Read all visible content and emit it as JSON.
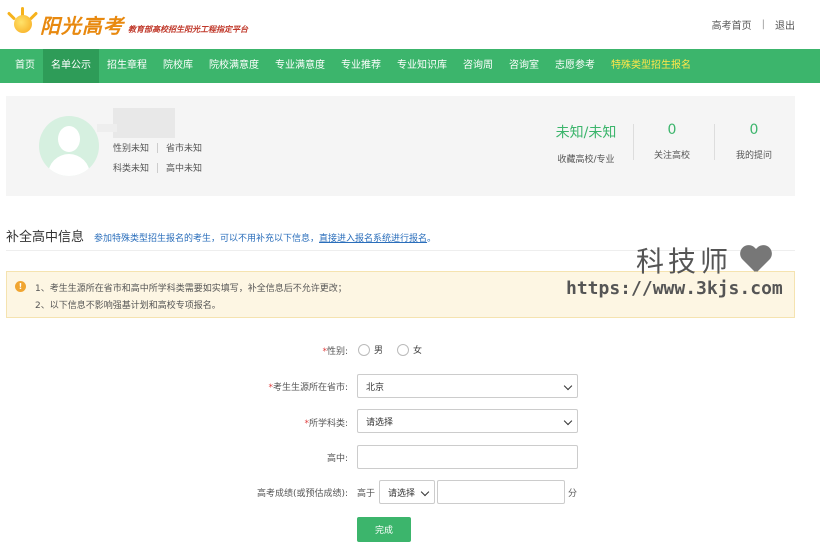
{
  "header": {
    "logo_title": "阳光高考",
    "logo_subtitle": "教育部高校招生阳光工程指定平台",
    "links": [
      "高考首页",
      "退出"
    ],
    "separator": "|"
  },
  "nav": {
    "items": [
      "首页",
      "名单公示",
      "招生章程",
      "院校库",
      "院校满意度",
      "专业满意度",
      "专业推荐",
      "专业知识库",
      "咨询周",
      "咨询室",
      "志愿参考",
      "特殊类型招生报名"
    ],
    "active_index": 1,
    "accent_color": "#3cb56c",
    "special_color": "#ffe64a"
  },
  "profile": {
    "gender": "性别未知",
    "province": "省市未知",
    "subject": "科类未知",
    "school": "高中未知",
    "stats": [
      {
        "value": "未知/未知",
        "label": "收藏高校/专业"
      },
      {
        "value": "0",
        "label": "关注高校"
      },
      {
        "value": "0",
        "label": "我的提问"
      }
    ]
  },
  "section": {
    "title": "补全高中信息",
    "note_prefix": "参加特殊类型招生报名的考生，可以不用补充以下信息，",
    "note_link": "直接进入报名系统进行报名",
    "note_suffix": "。"
  },
  "alert": {
    "icon": "exclamation-icon",
    "lines": [
      "1、考生生源所在省市和高中所学科类需要如实填写，补全信息后不允许更改；",
      "2、以下信息不影响强基计划和高校专项报名。"
    ]
  },
  "watermark": {
    "text": "科技师",
    "url": "https://www.3kjs.com"
  },
  "form": {
    "required_mark": "*",
    "gender_label": "性别:",
    "gender_options": [
      "男",
      "女"
    ],
    "province_label": "考生生源所在省市:",
    "province_value": "北京",
    "subject_label": "所学科类:",
    "subject_value": "请选择",
    "school_label": "高中:",
    "school_value": "",
    "score_label": "高考成绩(或预估成绩):",
    "score_prefix": "高于",
    "score_select": "请选择",
    "score_value": "",
    "score_unit": "分",
    "submit_label": "完成"
  }
}
